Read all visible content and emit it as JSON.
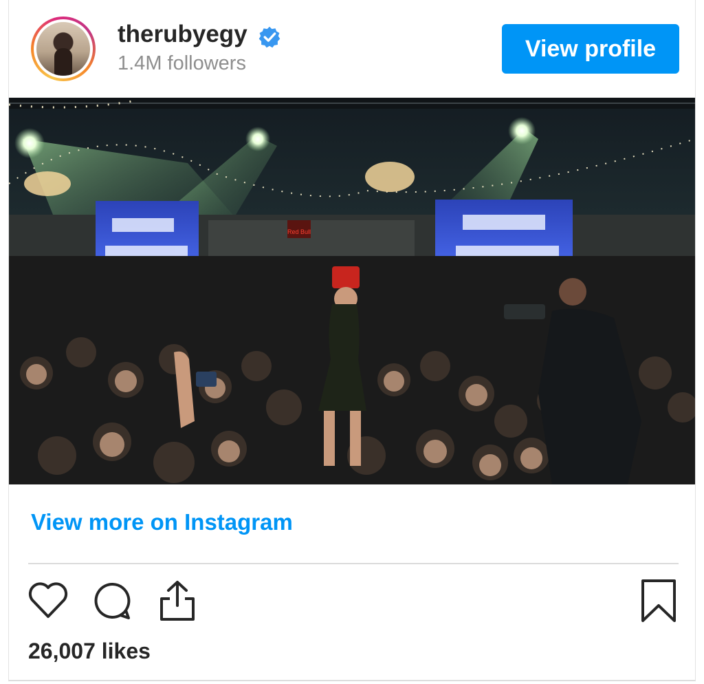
{
  "header": {
    "username": "therubyegy",
    "followers": "1.4M followers",
    "view_profile_label": "View profile",
    "verified_icon": "verified-badge-icon",
    "brand_blue": "#0095f6"
  },
  "post": {
    "image_desc_icon": "concert-photo",
    "view_more_label": "View more on Instagram",
    "likes": "26,007 likes"
  },
  "actions": {
    "like_icon": "heart-icon",
    "comment_icon": "comment-icon",
    "share_icon": "share-icon",
    "save_icon": "bookmark-icon"
  }
}
